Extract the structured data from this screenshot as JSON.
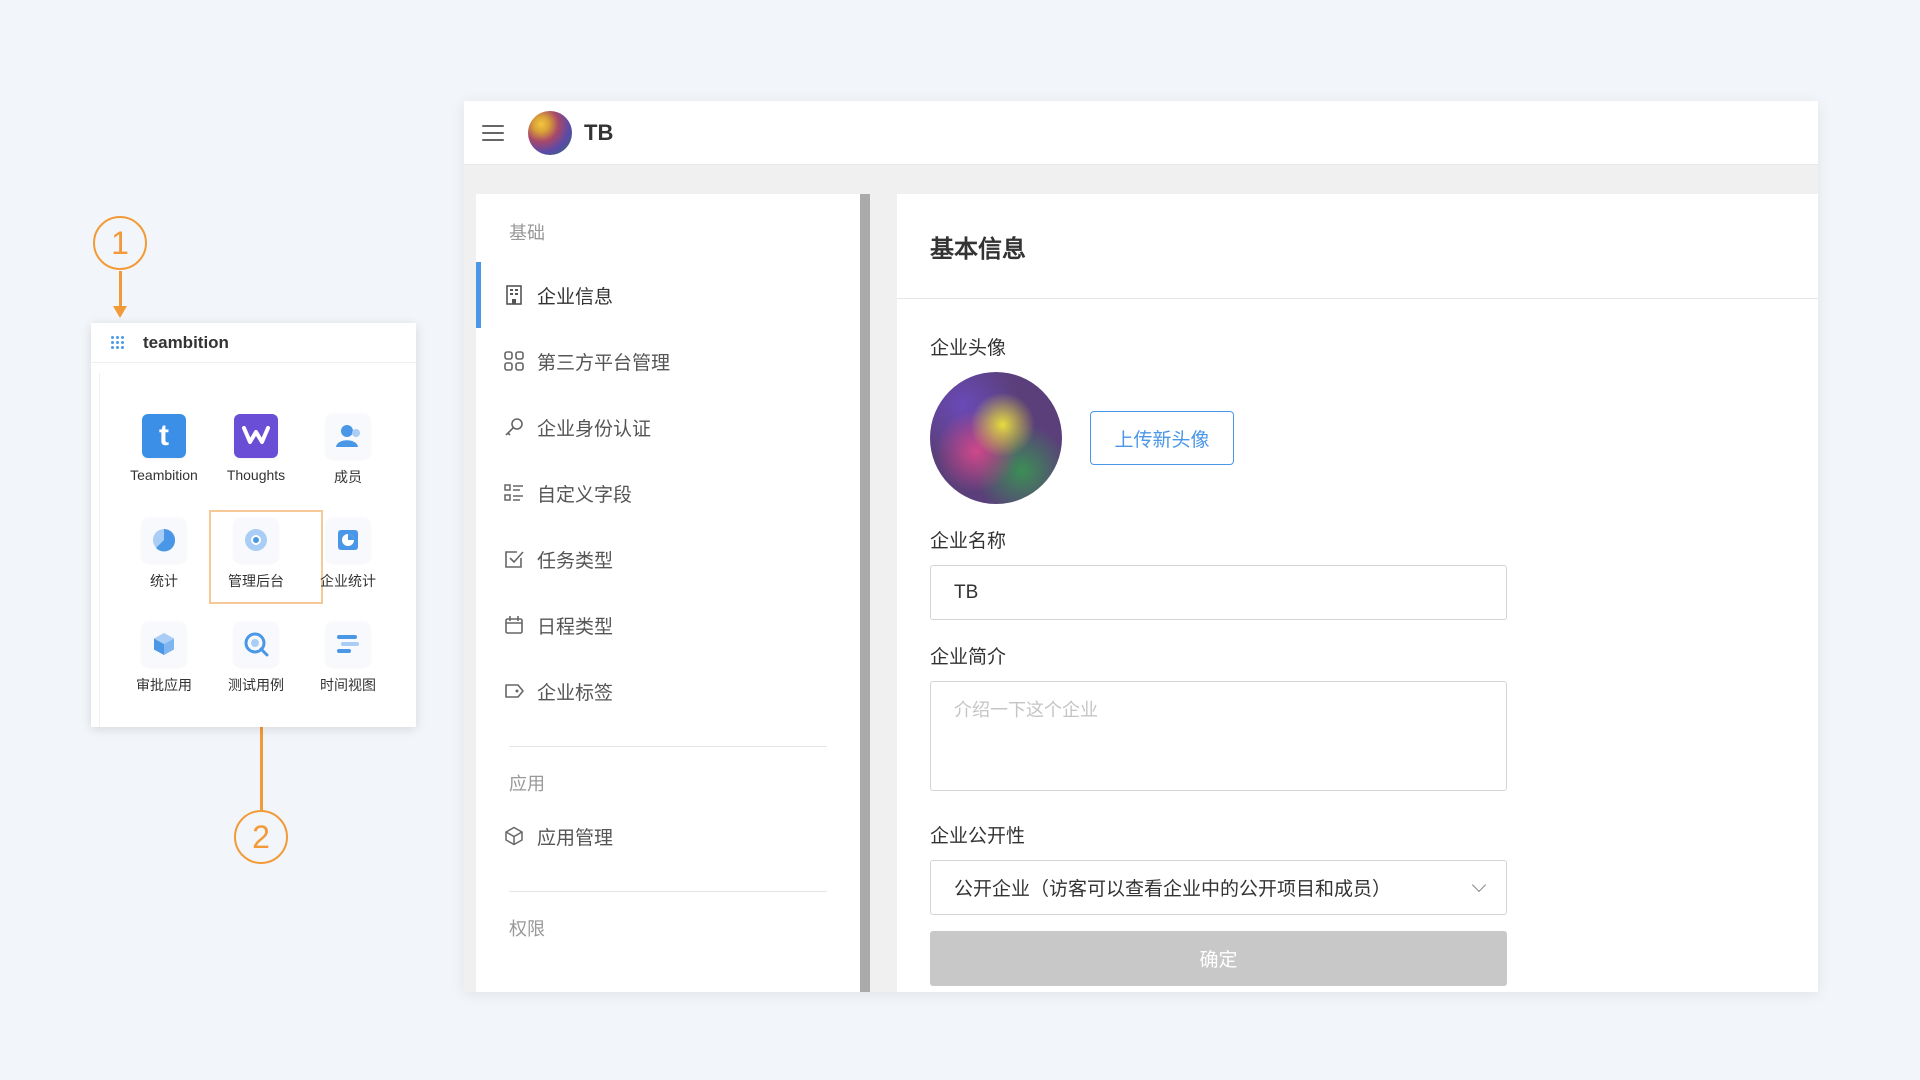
{
  "callouts": {
    "first": "1",
    "second": "2"
  },
  "launcher": {
    "title": "teambition",
    "apps": [
      {
        "label": "Teambition",
        "icon": "teambition-logo-icon"
      },
      {
        "label": "Thoughts",
        "icon": "thoughts-logo-icon"
      },
      {
        "label": "成员",
        "icon": "members-icon"
      },
      {
        "label": "统计",
        "icon": "pie-chart-icon"
      },
      {
        "label": "管理后台",
        "icon": "admin-console-icon"
      },
      {
        "label": "企业统计",
        "icon": "org-statistics-icon"
      },
      {
        "label": "审批应用",
        "icon": "approval-cube-icon"
      },
      {
        "label": "测试用例",
        "icon": "test-case-icon"
      },
      {
        "label": "时间视图",
        "icon": "timeline-icon"
      }
    ],
    "tile_letter": "t"
  },
  "topbar": {
    "org_name": "TB"
  },
  "sidebar": {
    "section_basic": "基础",
    "items": [
      {
        "label": "企业信息",
        "icon": "building-icon"
      },
      {
        "label": "第三方平台管理",
        "icon": "grid-apps-icon"
      },
      {
        "label": "企业身份认证",
        "icon": "key-icon"
      },
      {
        "label": "自定义字段",
        "icon": "list-fields-icon"
      },
      {
        "label": "任务类型",
        "icon": "checkbox-icon"
      },
      {
        "label": "日程类型",
        "icon": "calendar-icon"
      },
      {
        "label": "企业标签",
        "icon": "tag-icon"
      }
    ],
    "section_apps": "应用",
    "app_items": [
      {
        "label": "应用管理",
        "icon": "cube-icon"
      }
    ],
    "section_permissions": "权限"
  },
  "content": {
    "title": "基本信息",
    "avatar_label": "企业头像",
    "upload_button": "上传新头像",
    "name_label": "企业名称",
    "name_value": "TB",
    "intro_label": "企业简介",
    "intro_placeholder": "介绍一下这个企业",
    "visibility_label": "企业公开性",
    "visibility_value": "公开企业（访客可以查看企业中的公开项目和成员）",
    "confirm_button": "确定"
  },
  "colors": {
    "accent": "#4a97e8",
    "callout": "#f29a38",
    "disabled_button": "#c8c8c8"
  }
}
